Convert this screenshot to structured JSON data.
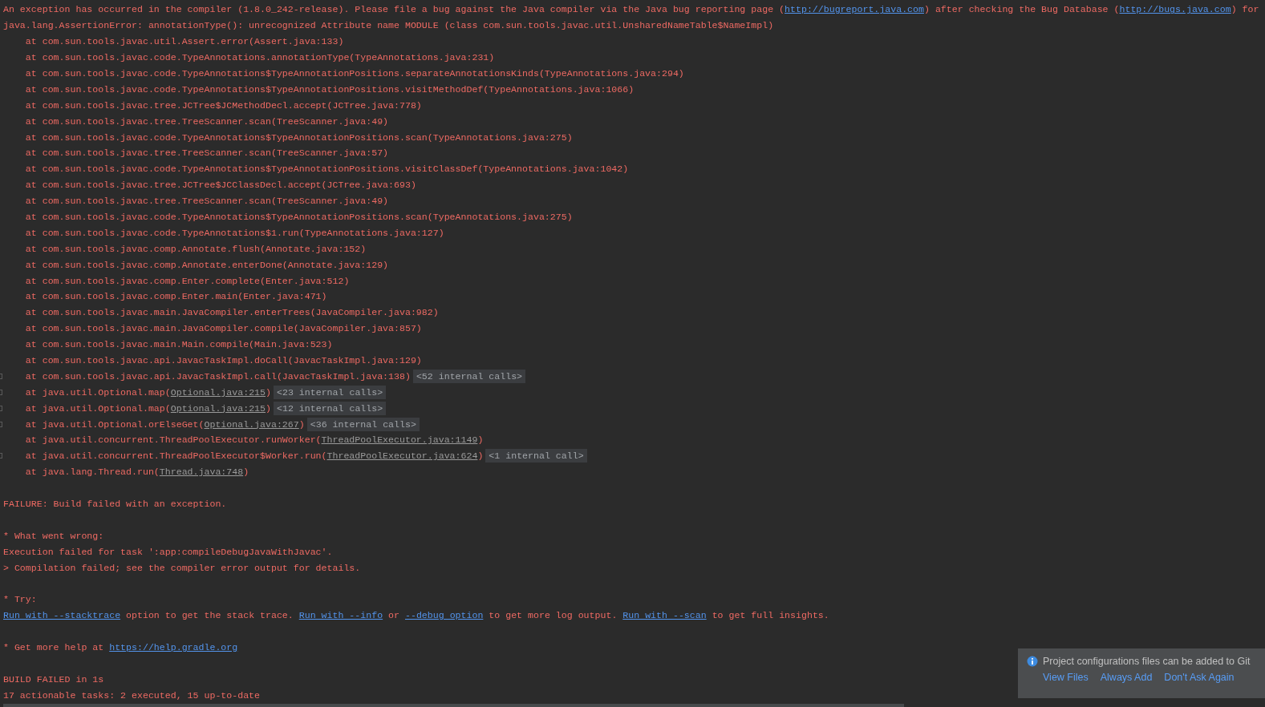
{
  "console": {
    "blocks": [
      {
        "lines": [
          {
            "segments": [
              {
                "kind": "text",
                "text": "An exception has occurred in the compiler (1.8.0_242-release). Please file a bug against the Java compiler via the Java bug reporting page ("
              },
              {
                "kind": "link",
                "text": "http://bugreport.java.com"
              },
              {
                "kind": "text",
                "text": ") after checking the Bug Database ("
              },
              {
                "kind": "link",
                "text": "http://bugs.java.com"
              },
              {
                "kind": "text",
                "text": ") for"
              }
            ]
          },
          {
            "segments": [
              {
                "kind": "text",
                "text": "java.lang.AssertionError: annotationType(): unrecognized Attribute name MODULE (class com.sun.tools.javac.util.UnsharedNameTable$NameImpl)"
              }
            ]
          },
          {
            "segments": [
              {
                "kind": "text",
                "text": "    at com.sun.tools.javac.util.Assert.error(Assert.java:133)"
              }
            ]
          },
          {
            "segments": [
              {
                "kind": "text",
                "text": "    at com.sun.tools.javac.code.TypeAnnotations.annotationType(TypeAnnotations.java:231)"
              }
            ]
          },
          {
            "segments": [
              {
                "kind": "text",
                "text": "    at com.sun.tools.javac.code.TypeAnnotations$TypeAnnotationPositions.separateAnnotationsKinds(TypeAnnotations.java:294)"
              }
            ]
          },
          {
            "segments": [
              {
                "kind": "text",
                "text": "    at com.sun.tools.javac.code.TypeAnnotations$TypeAnnotationPositions.visitMethodDef(TypeAnnotations.java:1066)"
              }
            ]
          },
          {
            "segments": [
              {
                "kind": "text",
                "text": "    at com.sun.tools.javac.tree.JCTree$JCMethodDecl.accept(JCTree.java:778)"
              }
            ]
          },
          {
            "segments": [
              {
                "kind": "text",
                "text": "    at com.sun.tools.javac.tree.TreeScanner.scan(TreeScanner.java:49)"
              }
            ]
          },
          {
            "segments": [
              {
                "kind": "text",
                "text": "    at com.sun.tools.javac.code.TypeAnnotations$TypeAnnotationPositions.scan(TypeAnnotations.java:275)"
              }
            ]
          },
          {
            "segments": [
              {
                "kind": "text",
                "text": "    at com.sun.tools.javac.tree.TreeScanner.scan(TreeScanner.java:57)"
              }
            ]
          },
          {
            "segments": [
              {
                "kind": "text",
                "text": "    at com.sun.tools.javac.code.TypeAnnotations$TypeAnnotationPositions.visitClassDef(TypeAnnotations.java:1042)"
              }
            ]
          },
          {
            "segments": [
              {
                "kind": "text",
                "text": "    at com.sun.tools.javac.tree.JCTree$JCClassDecl.accept(JCTree.java:693)"
              }
            ]
          },
          {
            "segments": [
              {
                "kind": "text",
                "text": "    at com.sun.tools.javac.tree.TreeScanner.scan(TreeScanner.java:49)"
              }
            ]
          },
          {
            "segments": [
              {
                "kind": "text",
                "text": "    at com.sun.tools.javac.code.TypeAnnotations$TypeAnnotationPositions.scan(TypeAnnotations.java:275)"
              }
            ]
          },
          {
            "segments": [
              {
                "kind": "text",
                "text": "    at com.sun.tools.javac.code.TypeAnnotations$1.run(TypeAnnotations.java:127)"
              }
            ]
          },
          {
            "segments": [
              {
                "kind": "text",
                "text": "    at com.sun.tools.javac.comp.Annotate.flush(Annotate.java:152)"
              }
            ]
          },
          {
            "segments": [
              {
                "kind": "text",
                "text": "    at com.sun.tools.javac.comp.Annotate.enterDone(Annotate.java:129)"
              }
            ]
          },
          {
            "segments": [
              {
                "kind": "text",
                "text": "    at com.sun.tools.javac.comp.Enter.complete(Enter.java:512)"
              }
            ]
          },
          {
            "segments": [
              {
                "kind": "text",
                "text": "    at com.sun.tools.javac.comp.Enter.main(Enter.java:471)"
              }
            ]
          },
          {
            "segments": [
              {
                "kind": "text",
                "text": "    at com.sun.tools.javac.main.JavaCompiler.enterTrees(JavaCompiler.java:982)"
              }
            ]
          },
          {
            "segments": [
              {
                "kind": "text",
                "text": "    at com.sun.tools.javac.main.JavaCompiler.compile(JavaCompiler.java:857)"
              }
            ]
          },
          {
            "segments": [
              {
                "kind": "text",
                "text": "    at com.sun.tools.javac.main.Main.compile(Main.java:523)"
              }
            ]
          },
          {
            "segments": [
              {
                "kind": "text",
                "text": "    at com.sun.tools.javac.api.JavacTaskImpl.doCall(JavacTaskImpl.java:129)"
              }
            ]
          },
          {
            "segments": [
              {
                "kind": "text",
                "text": "    at com.sun.tools.javac.api.JavacTaskImpl.call(JavacTaskImpl.java:138)"
              },
              {
                "kind": "fold",
                "text": "<52 internal calls>"
              }
            ]
          },
          {
            "segments": [
              {
                "kind": "text",
                "text": "    at java.util.Optional.map("
              },
              {
                "kind": "file",
                "text": "Optional.java:215"
              },
              {
                "kind": "text",
                "text": ")"
              },
              {
                "kind": "fold",
                "text": "<23 internal calls>"
              }
            ]
          },
          {
            "segments": [
              {
                "kind": "text",
                "text": "    at java.util.Optional.map("
              },
              {
                "kind": "file",
                "text": "Optional.java:215"
              },
              {
                "kind": "text",
                "text": ")"
              },
              {
                "kind": "fold",
                "text": "<12 internal calls>"
              }
            ]
          },
          {
            "segments": [
              {
                "kind": "text",
                "text": "    at java.util.Optional.orElseGet("
              },
              {
                "kind": "file",
                "text": "Optional.java:267"
              },
              {
                "kind": "text",
                "text": ")"
              },
              {
                "kind": "fold",
                "text": "<36 internal calls>"
              }
            ]
          },
          {
            "segments": [
              {
                "kind": "text",
                "text": "    at java.util.concurrent.ThreadPoolExecutor.runWorker("
              },
              {
                "kind": "file",
                "text": "ThreadPoolExecutor.java:1149"
              },
              {
                "kind": "text",
                "text": ")"
              }
            ]
          },
          {
            "segments": [
              {
                "kind": "text",
                "text": "    at java.util.concurrent.ThreadPoolExecutor$Worker.run("
              },
              {
                "kind": "file",
                "text": "ThreadPoolExecutor.java:624"
              },
              {
                "kind": "text",
                "text": ")"
              },
              {
                "kind": "fold",
                "text": "<1 internal call>"
              }
            ]
          },
          {
            "segments": [
              {
                "kind": "text",
                "text": "    at java.lang.Thread.run("
              },
              {
                "kind": "file",
                "text": "Thread.java:748"
              },
              {
                "kind": "text",
                "text": ")"
              }
            ]
          }
        ]
      },
      {
        "lines": [
          {
            "segments": [
              {
                "kind": "text",
                "text": "FAILURE: Build failed with an exception."
              }
            ]
          }
        ]
      },
      {
        "lines": [
          {
            "segments": [
              {
                "kind": "text",
                "text": "* What went wrong:"
              }
            ]
          },
          {
            "segments": [
              {
                "kind": "text",
                "text": "Execution failed for task ':app:compileDebugJavaWithJavac'."
              }
            ]
          },
          {
            "segments": [
              {
                "kind": "text",
                "text": "> Compilation failed; see the compiler error output for details."
              }
            ]
          }
        ]
      },
      {
        "lines": [
          {
            "segments": [
              {
                "kind": "text",
                "text": "* Try:"
              }
            ]
          },
          {
            "segments": [
              {
                "kind": "link",
                "text": "Run with --stacktrace"
              },
              {
                "kind": "text",
                "text": " option to get the stack trace. "
              },
              {
                "kind": "link",
                "text": "Run with --info"
              },
              {
                "kind": "text",
                "text": " or "
              },
              {
                "kind": "link",
                "text": "--debug option"
              },
              {
                "kind": "text",
                "text": " to get more log output. "
              },
              {
                "kind": "link",
                "text": "Run with --scan"
              },
              {
                "kind": "text",
                "text": " to get full insights."
              }
            ]
          }
        ]
      },
      {
        "lines": [
          {
            "segments": [
              {
                "kind": "text",
                "text": "* Get more help at "
              },
              {
                "kind": "link",
                "text": "https://help.gradle.org"
              }
            ]
          }
        ]
      },
      {
        "lines": [
          {
            "segments": [
              {
                "kind": "text",
                "text": "BUILD FAILED in 1s"
              }
            ]
          },
          {
            "segments": [
              {
                "kind": "text",
                "text": "17 actionable tasks: 2 executed, 15 up-to-date"
              }
            ]
          }
        ]
      }
    ]
  },
  "notification": {
    "message": "Project configurations files can be added to Git",
    "actions": [
      "View Files",
      "Always Add",
      "Don't Ask Again"
    ]
  }
}
